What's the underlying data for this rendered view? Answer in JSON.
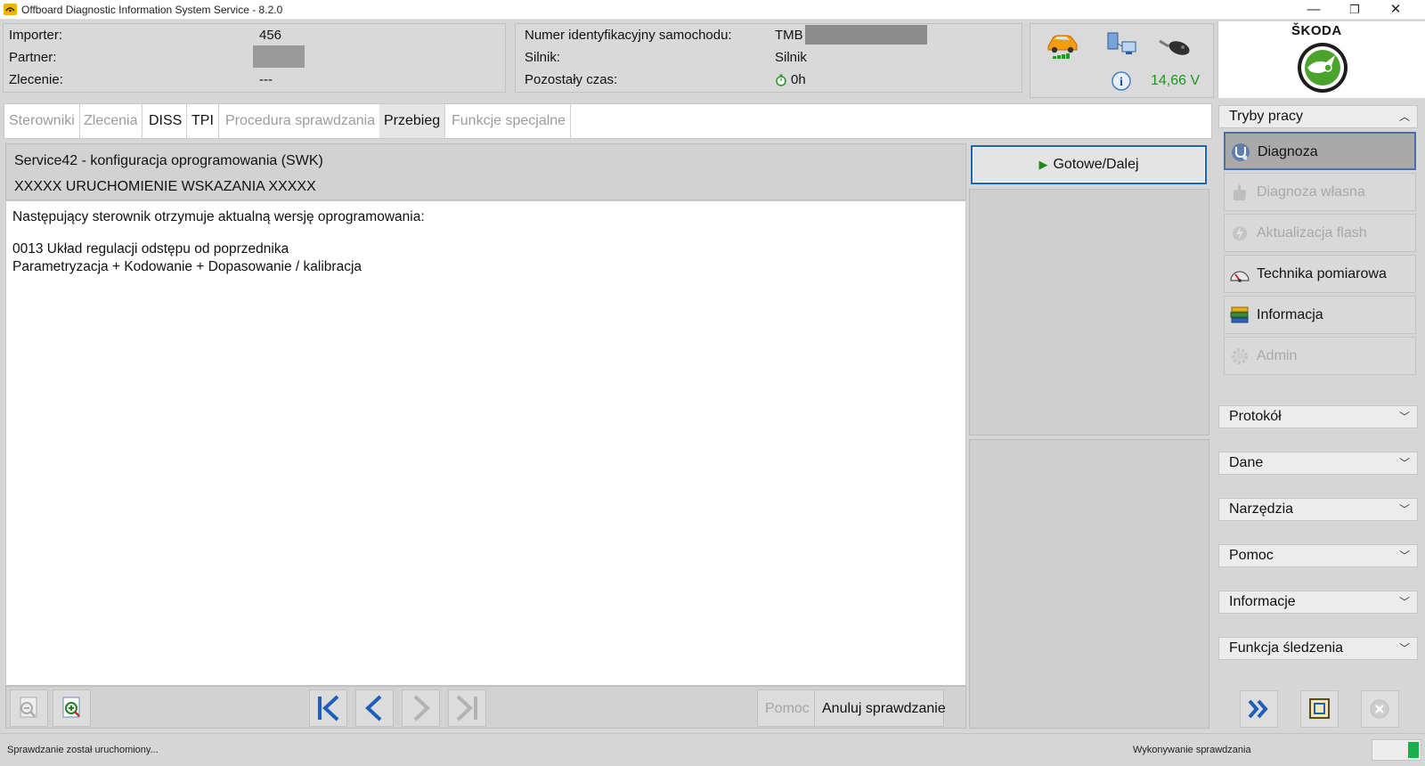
{
  "window": {
    "title": "Offboard Diagnostic Information System Service - 8.2.0",
    "minimize": "—",
    "maximize": "❐",
    "close": "✕"
  },
  "header": {
    "importer_label": "Importer:",
    "importer_value": "456",
    "partner_label": "Partner:",
    "order_label": "Zlecenie:",
    "order_value": "---",
    "vin_label": "Numer identyfikacyjny samochodu:",
    "vin_value": "TMB",
    "engine_label": "Silnik:",
    "engine_value": "Silnik",
    "time_label": "Pozostały czas:",
    "time_value": "0h",
    "voltage": "14,66 V",
    "voltage_color": "#1a9a1a",
    "brand": "ŠKODA",
    "brand_color": "#4aa32b"
  },
  "tabs": [
    {
      "label": "Sterowniki",
      "enabled": false
    },
    {
      "label": "Zlecenia",
      "enabled": false
    },
    {
      "label": "DISS",
      "enabled": true
    },
    {
      "label": "TPI",
      "enabled": true
    },
    {
      "label": "Procedura sprawdzania",
      "enabled": false
    },
    {
      "label": "Przebieg",
      "enabled": true,
      "active": true
    },
    {
      "label": "Funkcje specjalne",
      "enabled": false
    }
  ],
  "content": {
    "title1": "Service42 - konfiguracja oprogramowania (SWK)",
    "title2": "XXXXX URUCHOMIENIE WSKAZANIA XXXXX",
    "line1": "Następujący sterownik otrzymuje aktualną wersję oprogramowania:",
    "line2": "0013 Układ regulacji odstępu od poprzednika",
    "line3": "Parametryzacja + Kodowanie + Dopasowanie / kalibracja"
  },
  "buttons": {
    "next": "Gotowe/Dalej",
    "help": "Pomoc",
    "cancel": "Anuluj sprawdzanie"
  },
  "sidebar": {
    "modes_header": "Tryby pracy",
    "modes": [
      {
        "label": "Diagnoza",
        "state": "active",
        "icon": "stethoscope-icon"
      },
      {
        "label": "Diagnoza własna",
        "state": "disabled",
        "icon": "hand-icon"
      },
      {
        "label": "Aktualizacja flash",
        "state": "disabled",
        "icon": "flash-update-icon"
      },
      {
        "label": "Technika pomiarowa",
        "state": "enabled",
        "icon": "gauge-icon"
      },
      {
        "label": "Informacja",
        "state": "enabled",
        "icon": "books-icon"
      },
      {
        "label": "Admin",
        "state": "disabled",
        "icon": "gear-icon"
      }
    ],
    "sections": [
      "Protokół",
      "Dane",
      "Narzędzia",
      "Pomoc",
      "Informacje",
      "Funkcja śledzenia"
    ]
  },
  "status": {
    "left": "Sprawdzanie został uruchomiony...",
    "right": "Wykonywanie sprawdzania"
  }
}
